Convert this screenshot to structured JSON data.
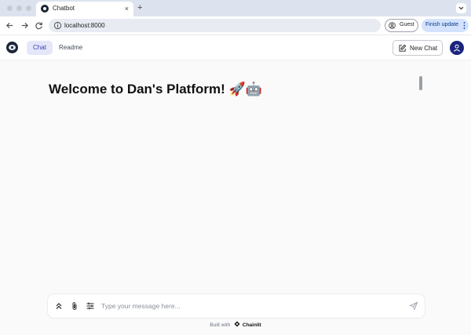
{
  "browser": {
    "tab_title": "Chatbot",
    "new_tab_glyph": "+",
    "close_glyph": "×",
    "url": "localhost:8000",
    "guest_label": "Guest",
    "update_label": "Finish update",
    "icons": [
      "back-icon",
      "forward-icon",
      "reload-icon",
      "site-info-icon",
      "guest-profile-icon",
      "more-vert-icon"
    ]
  },
  "header": {
    "tabs": [
      {
        "label": "Chat",
        "active": true
      },
      {
        "label": "Readme",
        "active": false
      }
    ],
    "new_chat_label": "New Chat",
    "accent": "#3b42b8",
    "avatar_color": "#1a237e"
  },
  "main": {
    "welcome": "Welcome to Dan's Platform! 🚀🤖"
  },
  "composer": {
    "placeholder": "Type your message here...",
    "icons": [
      "chevrons-up-icon",
      "paperclip-icon",
      "sliders-icon",
      "send-icon"
    ]
  },
  "footer": {
    "prefix": "Built with",
    "brand": "Chainlit"
  }
}
